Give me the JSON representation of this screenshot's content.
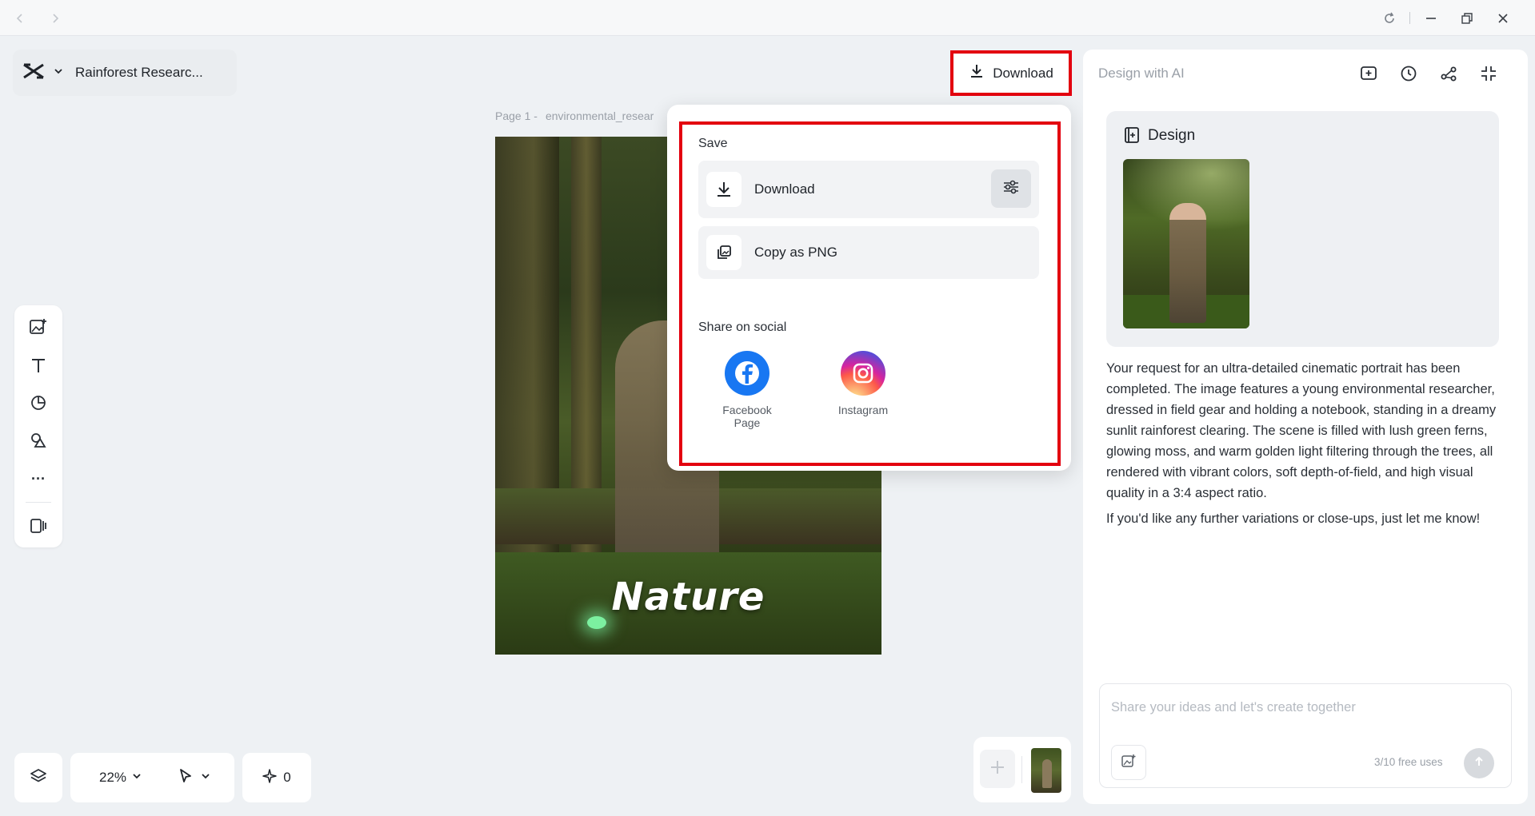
{
  "window": {
    "back_icon": "chevron-left-icon",
    "forward_icon": "chevron-right-icon",
    "controls": [
      "refresh-icon",
      "minimize-icon",
      "restore-icon",
      "close-icon"
    ]
  },
  "project": {
    "logo_icon": "capcut-logo-icon",
    "title": "Rainforest Researc..."
  },
  "top_download": {
    "label": "Download"
  },
  "left_toolbar": {
    "items": [
      "add-image-icon",
      "text-icon",
      "shapes-icon",
      "elements-icon",
      "more-icon",
      "layout-icon"
    ],
    "more_label": "···"
  },
  "canvas": {
    "page_prefix": "Page 1 -",
    "file_name": "environmental_resear",
    "caption": "Nature"
  },
  "popover": {
    "save_heading": "Save",
    "download_label": "Download",
    "copy_label": "Copy as PNG",
    "share_heading": "Share on social",
    "social": [
      {
        "name_line1": "Facebook",
        "name_line2": "Page",
        "color": "#1877f2"
      },
      {
        "name_line1": "Instagram",
        "name_line2": "",
        "color": "#d62976"
      }
    ]
  },
  "right_panel": {
    "title": "Design with AI",
    "card_title": "Design",
    "paragraph1": "Your request for an ultra-detailed cinematic portrait has been completed. The image features a young environmental researcher, dressed in field gear and holding a notebook, standing in a dreamy sunlit rainforest clearing. The scene is filled with lush green ferns, glowing moss, and warm golden light filtering through the trees, all rendered with vibrant colors, soft depth-of-field, and high visual quality in a 3:4 aspect ratio.",
    "paragraph2": "If you'd like any further variations or close-ups, just let me know!",
    "chat_placeholder": "Share your ideas and let's create together",
    "free_uses": "3/10 free uses"
  },
  "bottom": {
    "zoom": "22%",
    "credits": "0"
  },
  "colors": {
    "highlight": "#e3000f",
    "panel_bg": "#eef1f4"
  }
}
